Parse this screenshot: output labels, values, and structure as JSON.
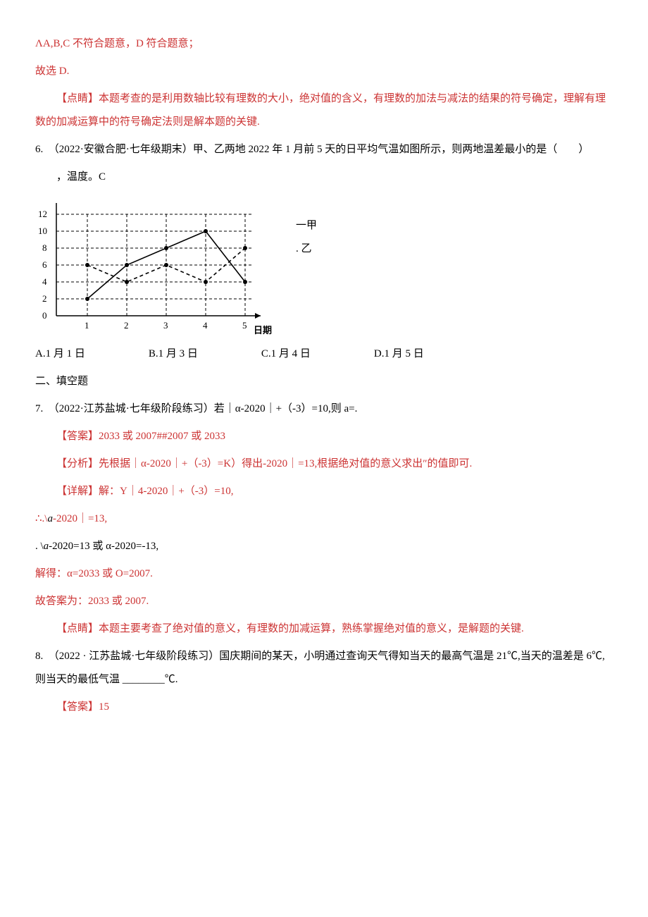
{
  "l1": "ΛA,B,C 不符合题意，D 符合题意；",
  "l2": "故选 D.",
  "l3": "【点睛】本题考查的是利用数轴比较有理数的大小，绝对值的含义，有理数的加法与减法的结果的符号确定，理解有理数的加减运算中的符号确定法则是解本题的关键.",
  "q6_prefix": "6.　（2022·安徽合肥·七年级期末）甲、乙两地 2022 年 1 月前 5 天的日平均气温如图所示，则两地温差最小的是（　　）",
  "chart_caption": "，温度。C",
  "legend_a": "一甲",
  "legend_b": ". 乙",
  "opt6_a": "A.1 月 1 日",
  "opt6_b": "B.1 月 3 日",
  "opt6_c": "C.1 月 4 日",
  "opt6_d": "D.1 月 5 日",
  "section2": "二、填空题",
  "q7": "7.　（2022·江苏盐城·七年级阶段练习）若｜α-2020｜+（-3）=10,则 a=.",
  "a7_ans": "【答案】2033 或 2007##2007 或 2033",
  "a7_analysis": "【分析】先根据｜α-2020｜+（-3）=K）得出-2020｜=13,根据绝对值的意义求出″的值即可.",
  "a7_detail": "【详解】解：Y｜4-2020｜+（-3）=10,",
  "a7_step1_pre": "∴.\\",
  "a7_step1_i": "a",
  "a7_step1_post": "-2020｜=13,",
  "a7_step2_pre": ". \\",
  "a7_step2_i": "a",
  "a7_step2_post": "-2020=13 或 α-2020=-13,",
  "a7_step3": "解得：α=2033 或 O=2007.",
  "a7_final": "故答案为：2033 或 2007.",
  "a7_tips": "【点睛】本题主要考查了绝对值的意义，有理数的加减运算，熟练掌握绝对值的意义，是解题的关键.",
  "q8": "8.　（2022 · 江苏盐城·七年级阶段练习）国庆期间的某天，小明通过查询天气得知当天的最高气温是 21℃,当天的温差是 6℃,则当天的最低气温 ________℃.",
  "a8_ans": "【答案】15",
  "chart_data": {
    "type": "line",
    "title": "",
    "xlabel": "日期",
    "ylabel": "温度 ℃",
    "categories": [
      1,
      2,
      3,
      4,
      5
    ],
    "series": [
      {
        "name": "甲",
        "values": [
          2,
          6,
          8,
          10,
          4
        ]
      },
      {
        "name": "乙",
        "values": [
          6,
          4,
          6,
          4,
          8
        ]
      }
    ],
    "ylim": [
      0,
      12
    ],
    "grid": true
  }
}
